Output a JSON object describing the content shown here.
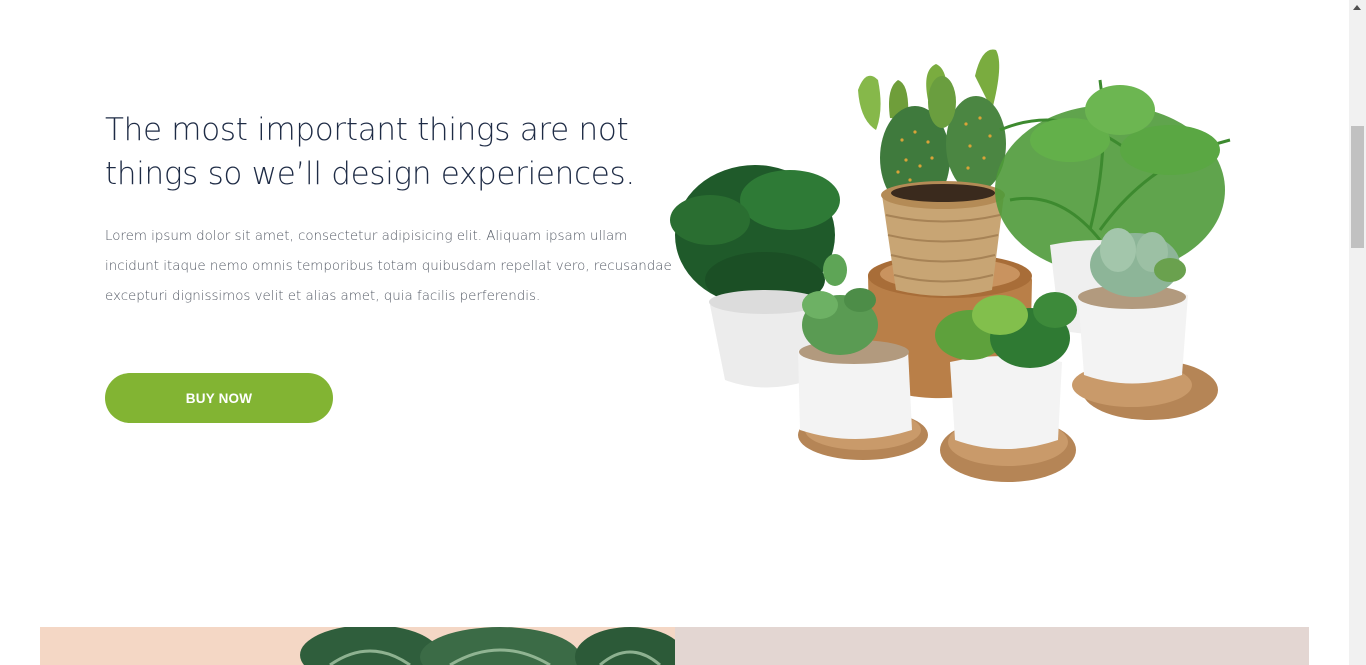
{
  "hero": {
    "title": "The most important things are not things so we’ll design experiences.",
    "body": "Lorem ipsum dolor sit amet, consectetur adipisicing elit. Aliquam ipsam ullam incidunt itaque nemo omnis temporibus totam quibusdam repellat vero, recusandae excepturi dignissimos velit et alias amet, quia facilis perferendis.",
    "button_label": "BUY NOW"
  },
  "colors": {
    "accent": "#82b433",
    "title": "#1e2b45",
    "body_text": "#555b66",
    "panel_left": "#f4d7c5",
    "panel_right": "#e3d6d2"
  },
  "icons": {
    "scroll_up": "chevron-up-icon"
  }
}
